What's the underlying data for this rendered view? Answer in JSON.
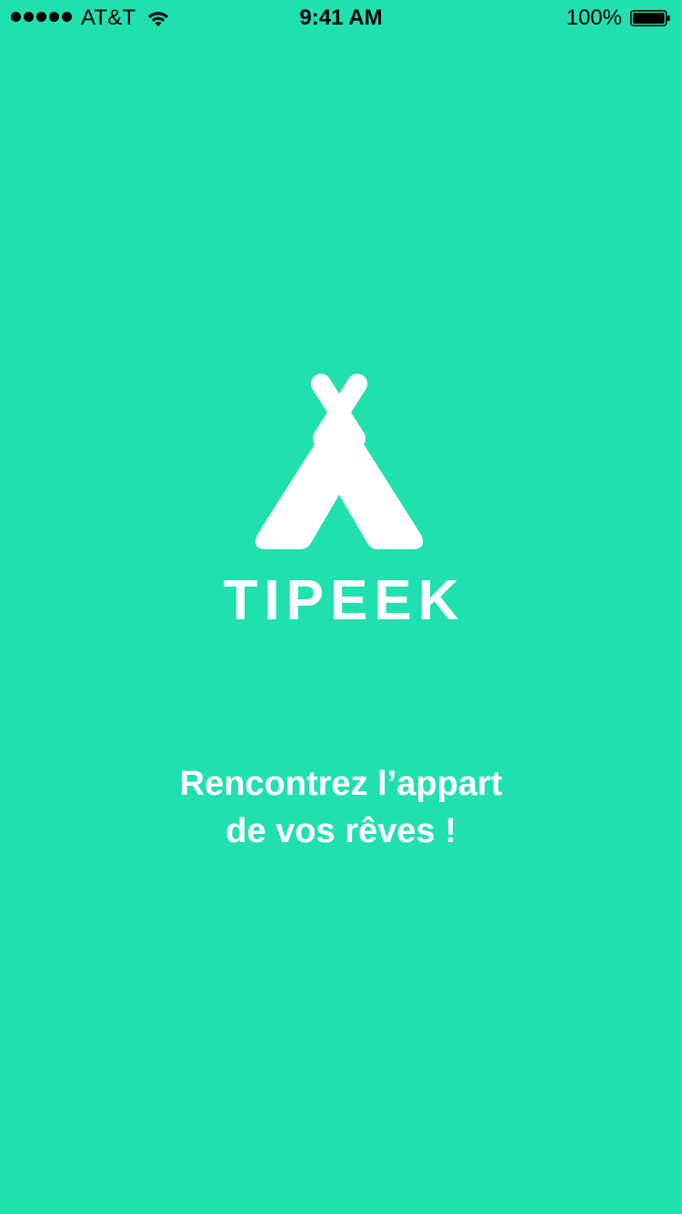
{
  "status_bar": {
    "carrier": "AT&T",
    "time": "9:41 AM",
    "battery_percent": "100%",
    "signal_bars": 5,
    "icons": [
      "signal-dots-icon",
      "wifi-icon",
      "battery-icon"
    ]
  },
  "splash": {
    "logo_icon": "tipi-tent-icon",
    "brand_name": "TIPEEK",
    "tagline_line1": "Rencontrez l’appart",
    "tagline_line2": "de vos rêves !"
  },
  "colors": {
    "background": "#21E0B0",
    "foreground": "#FFFFFF",
    "status_text": "#000000"
  }
}
